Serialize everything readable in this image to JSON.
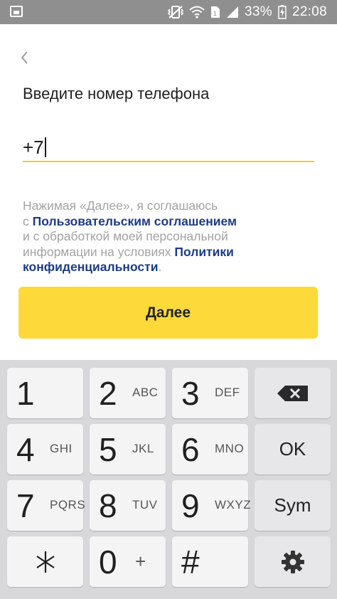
{
  "status_bar": {
    "battery_percent": "33%",
    "time": "22:08",
    "icons": [
      "gallery-icon",
      "vibrate-icon",
      "wifi-icon",
      "sim-icon",
      "signal-icon",
      "charging-icon"
    ]
  },
  "header": {
    "back_icon": "chevron-left-icon",
    "title": "Введите номер телефона"
  },
  "phone_input": {
    "value": "+7",
    "accent_color": "#f5cd1f"
  },
  "consent": {
    "line1": "Нажимая «Далее», я соглашаюсь",
    "line2_prefix": "с ",
    "user_agreement_link": "Пользовательским соглашением",
    "line3": "и с обработкой моей персональной",
    "line4_prefix": "информации на условиях ",
    "policy_link_part1": "Политики",
    "policy_link_part2": "конфиденциальности",
    "suffix": "."
  },
  "next_button": {
    "label": "Далее",
    "color": "#fdd93a"
  },
  "keyboard": {
    "keys": [
      {
        "digit": "1",
        "letters": ""
      },
      {
        "digit": "2",
        "letters": "ABC"
      },
      {
        "digit": "3",
        "letters": "DEF"
      },
      {
        "label": "backspace",
        "icon": "backspace-icon"
      },
      {
        "digit": "4",
        "letters": "GHI"
      },
      {
        "digit": "5",
        "letters": "JKL"
      },
      {
        "digit": "6",
        "letters": "MNO"
      },
      {
        "label": "OK"
      },
      {
        "digit": "7",
        "letters": "PQRS"
      },
      {
        "digit": "8",
        "letters": "TUV"
      },
      {
        "digit": "9",
        "letters": "WXYZ"
      },
      {
        "label": "Sym"
      },
      {
        "digit": "*",
        "icon": "asterisk-icon"
      },
      {
        "digit": "0",
        "letters": "+"
      },
      {
        "digit": "#",
        "letters": ""
      },
      {
        "label": "settings",
        "icon": "gear-icon"
      }
    ]
  }
}
